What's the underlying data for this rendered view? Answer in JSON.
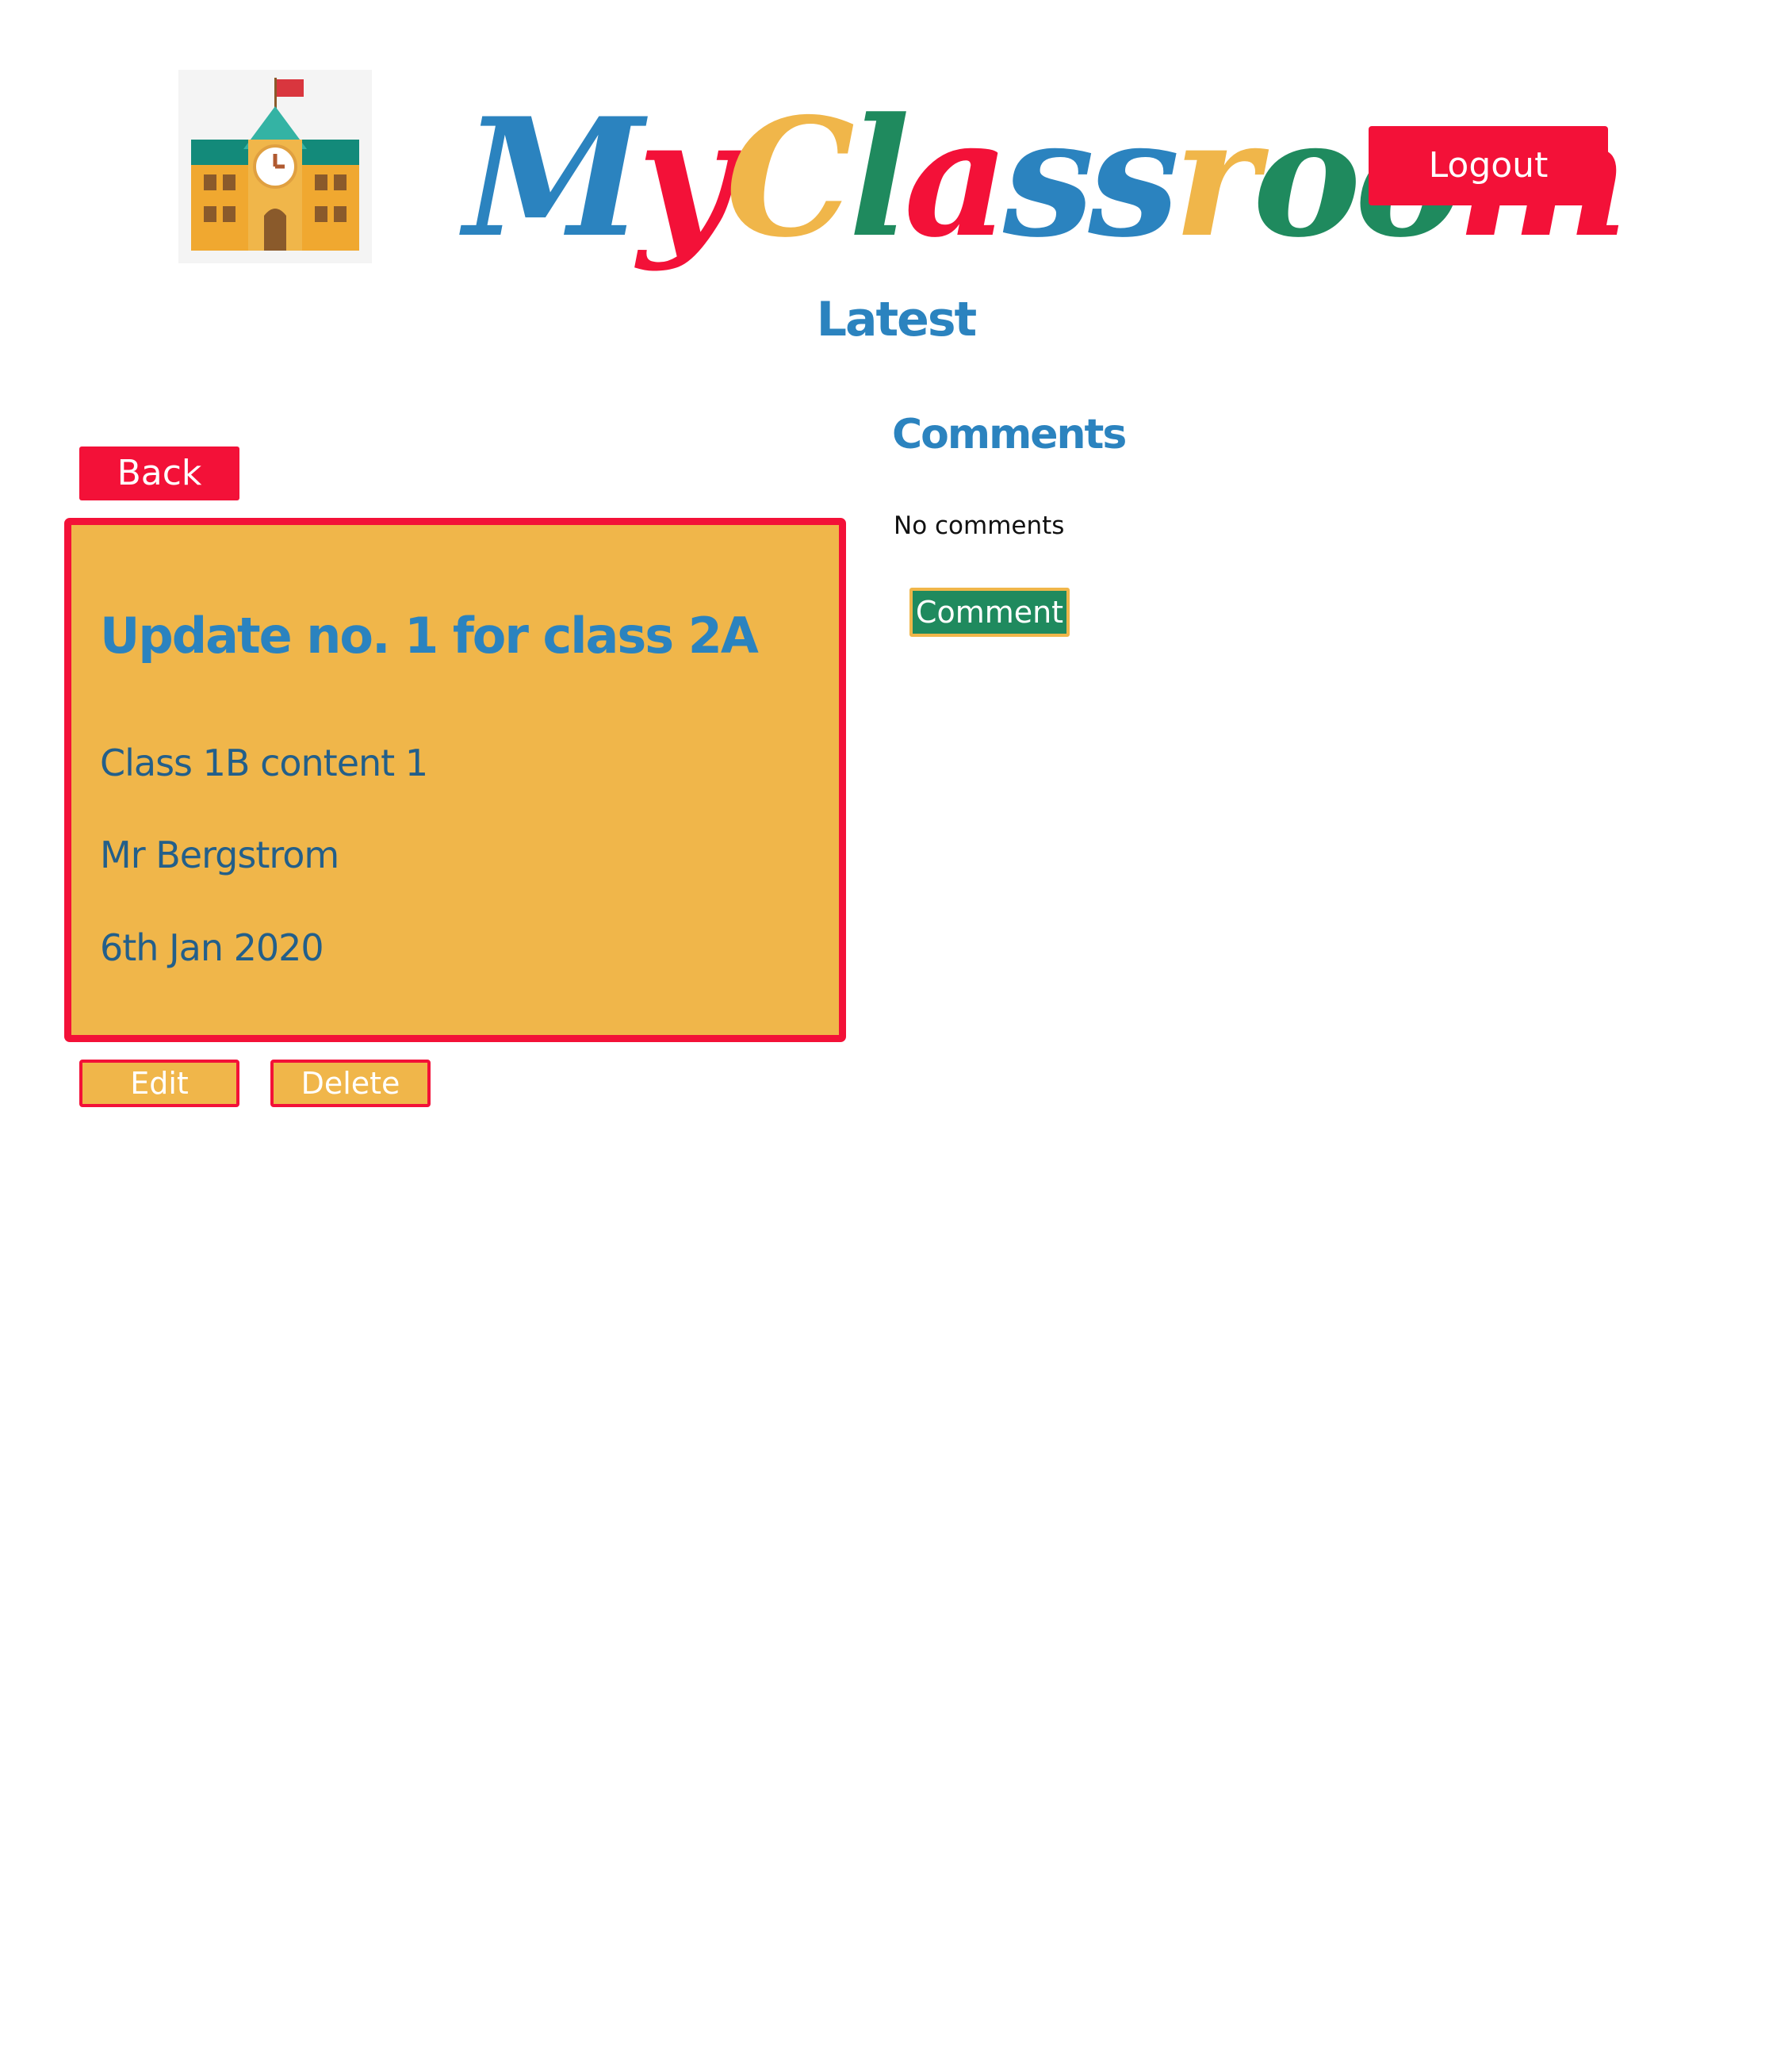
{
  "header": {
    "logo_icon": "school-building-icon",
    "brand_letters": [
      {
        "char": "M",
        "color": "#2b83bf"
      },
      {
        "char": "y",
        "color": "#f31138"
      },
      {
        "char": "C",
        "color": "#f0b64a"
      },
      {
        "char": "l",
        "color": "#1f8a5e"
      },
      {
        "char": "a",
        "color": "#f31138"
      },
      {
        "char": "s",
        "color": "#2b83bf"
      },
      {
        "char": "s",
        "color": "#2b83bf"
      },
      {
        "char": "r",
        "color": "#f0b64a"
      },
      {
        "char": "o",
        "color": "#1f8a5e"
      },
      {
        "char": "o",
        "color": "#1f8a5e"
      },
      {
        "char": "m",
        "color": "#f31138"
      }
    ],
    "logout_label": "Logout"
  },
  "page_title": "Latest",
  "post": {
    "back_label": "Back",
    "title": "Update no. 1 for class 2A",
    "content": "Class 1B content 1",
    "author": "Mr Bergstrom",
    "date": "6th Jan 2020",
    "edit_label": "Edit",
    "delete_label": "Delete"
  },
  "comments": {
    "heading": "Comments",
    "empty_text": "No comments",
    "comment_label": "Comment"
  },
  "colors": {
    "red": "#f31138",
    "yellow": "#f0b64a",
    "blue": "#2b83bf",
    "green": "#1f8a5e",
    "dark_blue": "#235f8a"
  }
}
